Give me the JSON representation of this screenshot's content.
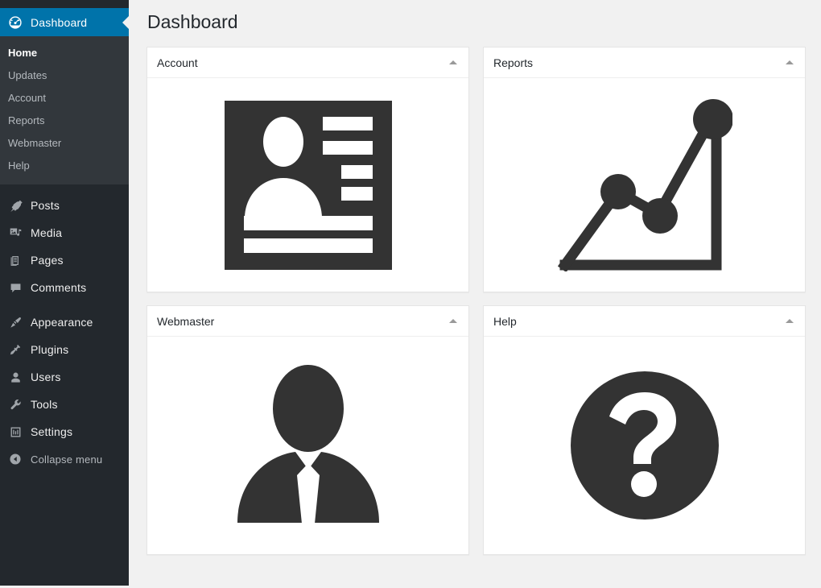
{
  "sidebar": {
    "current_menu": {
      "label": "Dashboard",
      "icon": "dashboard-icon",
      "color": "#0073aa"
    },
    "submenu": [
      {
        "label": "Home",
        "current": true
      },
      {
        "label": "Updates",
        "current": false
      },
      {
        "label": "Account",
        "current": false
      },
      {
        "label": "Reports",
        "current": false
      },
      {
        "label": "Webmaster",
        "current": false
      },
      {
        "label": "Help",
        "current": false
      }
    ],
    "group_one": [
      {
        "label": "Posts",
        "icon": "pin-icon"
      },
      {
        "label": "Media",
        "icon": "media-icon"
      },
      {
        "label": "Pages",
        "icon": "pages-icon"
      },
      {
        "label": "Comments",
        "icon": "comment-icon"
      }
    ],
    "group_two": [
      {
        "label": "Appearance",
        "icon": "paintbrush-icon"
      },
      {
        "label": "Plugins",
        "icon": "plug-icon"
      },
      {
        "label": "Users",
        "icon": "user-icon"
      },
      {
        "label": "Tools",
        "icon": "wrench-icon"
      },
      {
        "label": "Settings",
        "icon": "settings-icon"
      }
    ],
    "collapse": {
      "label": "Collapse menu",
      "icon": "collapse-arrow-icon"
    }
  },
  "page": {
    "title": "Dashboard"
  },
  "panels": [
    {
      "title": "Account",
      "toggle": "collapse-toggle",
      "art": "id-card-icon"
    },
    {
      "title": "Reports",
      "toggle": "collapse-toggle",
      "art": "line-chart-icon"
    },
    {
      "title": "Webmaster",
      "toggle": "collapse-toggle",
      "art": "businessman-icon"
    },
    {
      "title": "Help",
      "toggle": "collapse-toggle",
      "art": "question-mark-icon"
    }
  ],
  "theme": {
    "sidebar_bg": "#23282d",
    "submenu_bg": "#32373c",
    "accent": "#0073aa",
    "content_bg": "#f1f1f1",
    "panel_bg": "#ffffff",
    "art_color": "#333333"
  }
}
